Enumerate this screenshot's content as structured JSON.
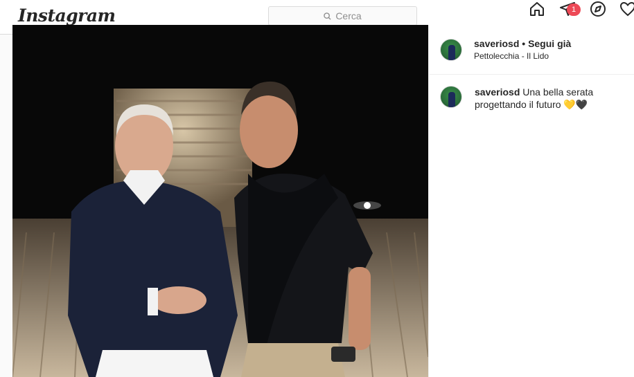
{
  "topbar": {
    "logo": "Instagram",
    "search_placeholder": "Cerca",
    "notification_count": "1",
    "icons": [
      "home-icon",
      "direct-icon",
      "explore-icon",
      "heart-icon"
    ]
  },
  "post": {
    "photo_alt": "Two men posing at night on a wooden deck",
    "header": {
      "username": "saveriosd",
      "separator": " • ",
      "follow_status": "Segui già",
      "location": "Pettolecchia - Il Lido"
    },
    "caption": {
      "username": "saveriosd",
      "text": "Una bella serata progettando il futuro",
      "emoji_1": "💛",
      "emoji_2": "🖤"
    }
  },
  "colors": {
    "badge": "#ed4956",
    "text": "#262626",
    "border": "#dbdbdb"
  }
}
